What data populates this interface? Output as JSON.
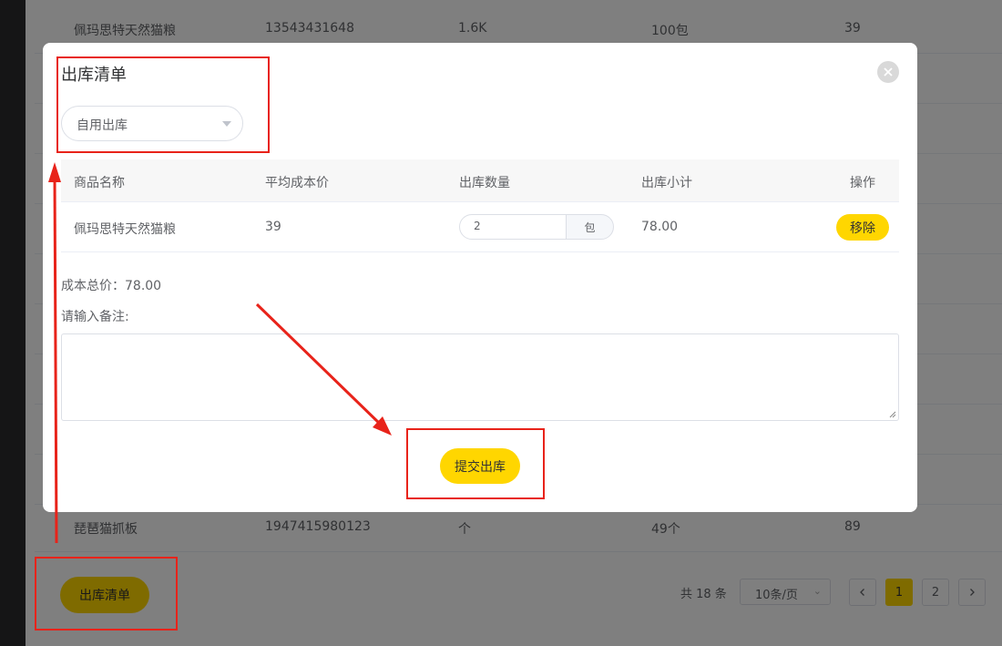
{
  "background": {
    "rows": [
      {
        "name": "佩玛思特天然猫粮",
        "code": "13543431648",
        "spec": "1.6K",
        "stock": "100包",
        "price": "39"
      },
      {
        "name": "琵琶猫抓板",
        "code": "1947415980123",
        "spec": "个",
        "stock": "49个",
        "price": "89"
      }
    ],
    "bottom_button_label": "出库清单",
    "pagination": {
      "total_label": "共 18 条",
      "page_size_label": "10条/页",
      "pages": [
        "1",
        "2"
      ],
      "current_page": "1"
    }
  },
  "dialog": {
    "title": "出库清单",
    "select_value": "自用出库",
    "table": {
      "headers": [
        "商品名称",
        "平均成本价",
        "出库数量",
        "出库小计",
        "操作"
      ],
      "rows": [
        {
          "name": "佩玛思特天然猫粮",
          "avg_cost": "39",
          "qty": "2",
          "unit": "包",
          "subtotal": "78.00",
          "action": "移除"
        }
      ]
    },
    "total_label": "成本总价：78.00",
    "note_label": "请输入备注:",
    "submit_label": "提交出库"
  },
  "colors": {
    "accent": "#ffd600",
    "annotation": "#e8231a"
  }
}
